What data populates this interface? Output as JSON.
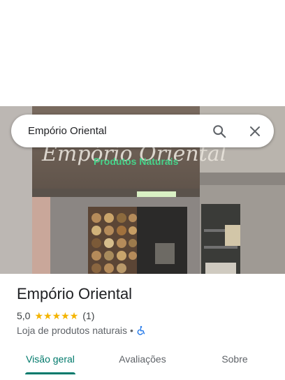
{
  "search": {
    "query": "Empório Oriental"
  },
  "photo": {
    "sign_script": "Empório Oriental",
    "sign_subtitle": "Produtos Naturais"
  },
  "place": {
    "name": "Empório Oriental",
    "rating": "5,0",
    "stars": 5,
    "review_count": "(1)",
    "category": "Loja de produtos naturais",
    "separator": "•"
  },
  "tabs": [
    {
      "label": "Visão geral",
      "active": true
    },
    {
      "label": "Avaliações",
      "active": false
    },
    {
      "label": "Sobre",
      "active": false
    }
  ],
  "colors": {
    "accent": "#00796b",
    "star": "#f4b400",
    "sign_green": "#46d38a"
  }
}
